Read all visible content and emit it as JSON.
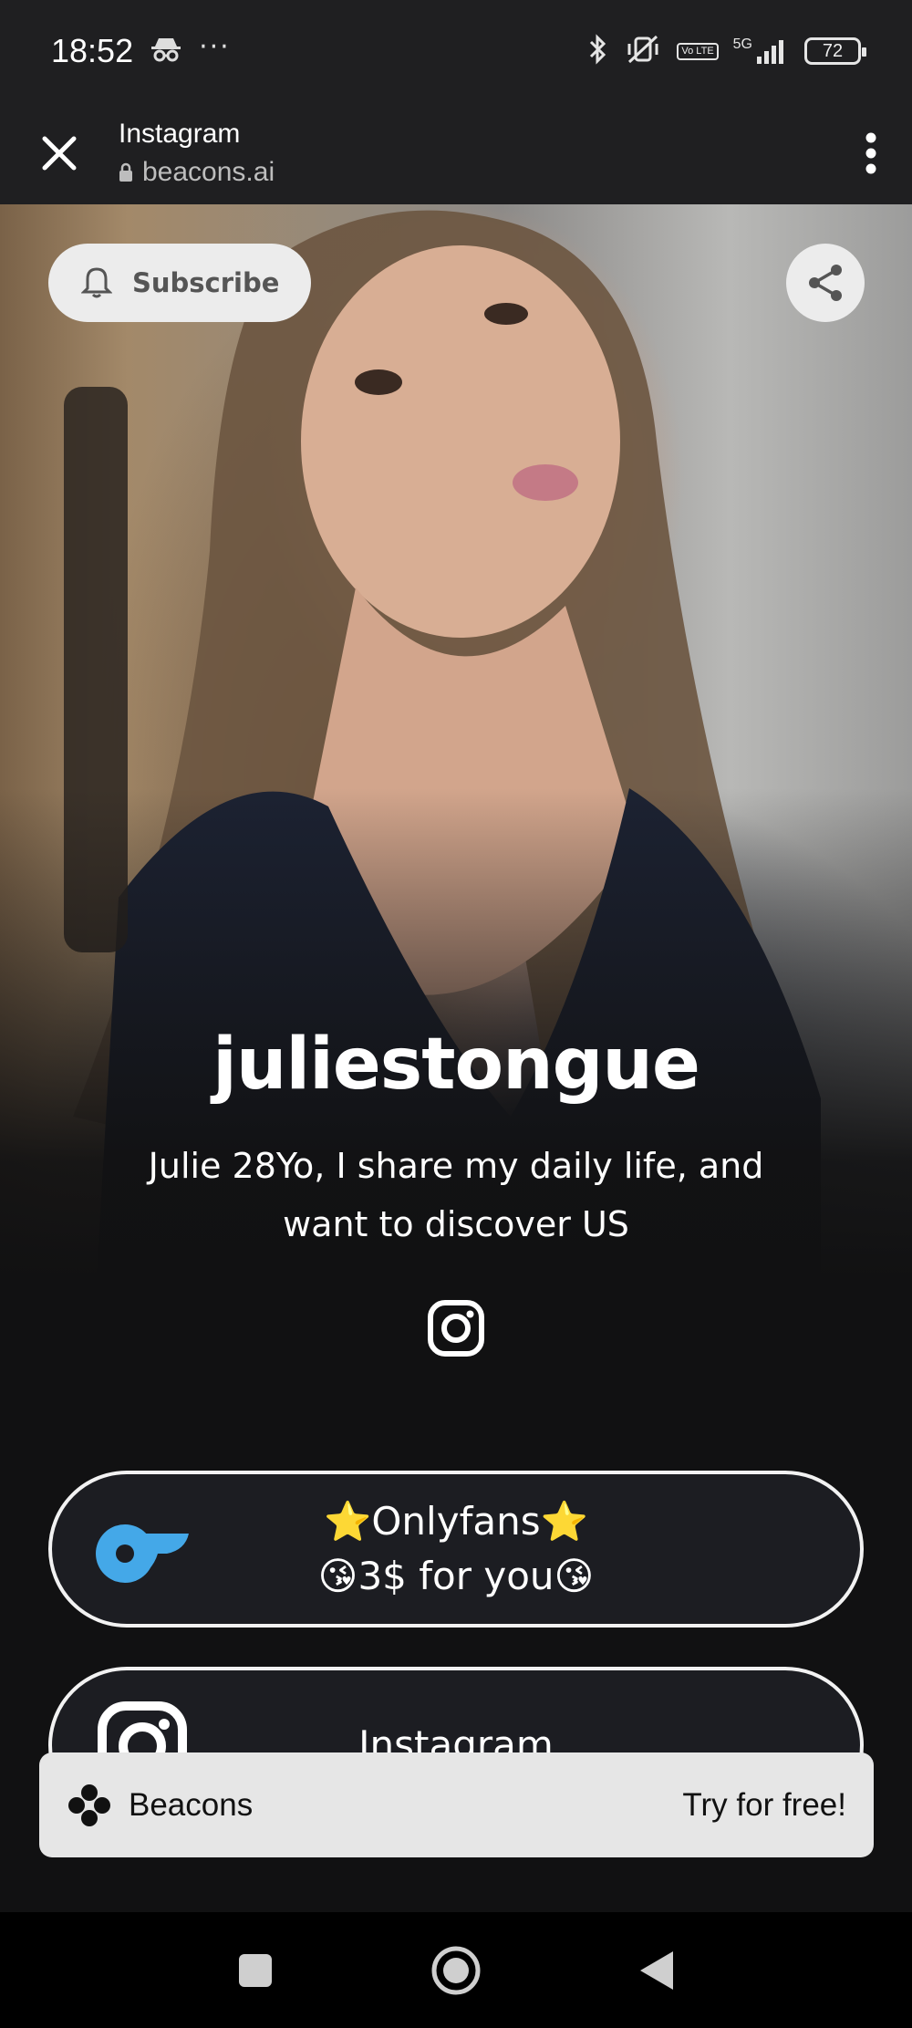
{
  "status_bar": {
    "time": "18:52",
    "dots": "···",
    "network": "5G",
    "volte": "Vo LTE",
    "battery": "72"
  },
  "browser": {
    "title": "Instagram",
    "host": "beacons.ai"
  },
  "profile": {
    "subscribe_label": "Subscribe",
    "username": "juliestongue",
    "bio": "Julie 28Yo, I share my daily life, and want to discover US"
  },
  "links": [
    {
      "line1": "⭐Onlyfans⭐",
      "line2": "😘3$ for you😘"
    },
    {
      "line1": "Instagram"
    }
  ],
  "banner": {
    "brand": "Beacons",
    "cta": "Try for free!"
  },
  "colors": {
    "onlyfans_blue": "#44a8e8",
    "chrome_dark": "#1f1f21"
  }
}
